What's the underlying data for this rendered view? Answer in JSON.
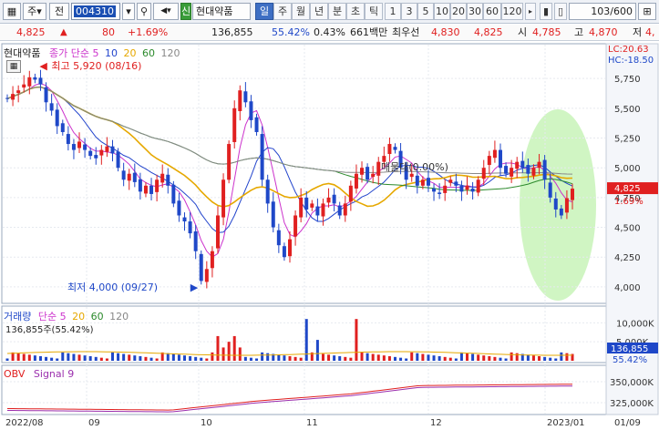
{
  "toolbar": {
    "market_type": "주",
    "prev_label": "전",
    "stock_code": "004310",
    "credit_badge": "신",
    "stock_name": "현대약품",
    "periods": [
      "일",
      "주",
      "월",
      "년",
      "분",
      "초",
      "틱"
    ],
    "active_period": "일",
    "numbers": [
      "1",
      "3",
      "5",
      "10",
      "20",
      "30",
      "60",
      "120"
    ],
    "count_display": "103/600"
  },
  "info": {
    "price": "4,825",
    "change_arrow": "▲",
    "change": "80",
    "change_pct": "+1.69%",
    "volume": "136,855",
    "vol_ratio": "55.42%",
    "turnover_pct": "0.43%",
    "amount": "661백만",
    "best_ask_label": "최우선",
    "best_ask": "4,830",
    "best_bid": "4,825",
    "open_label": "시",
    "open": "4,785",
    "high_label": "고",
    "high": "4,870",
    "low_label": "저",
    "low": "4,"
  },
  "price_pane": {
    "legend_name": "현대약품",
    "legend_ma_label": "종가 단순",
    "ma_periods": [
      "5",
      "10",
      "20",
      "60",
      "120"
    ],
    "ma_colors": [
      "#cc33cc",
      "#2244cc",
      "#e6a800",
      "#2c8a2c",
      "#888888"
    ],
    "lc_label": "LC:20.63",
    "hc_label": "HC:-18.50",
    "high_note": "최고 5,920 (08/16)",
    "low_note": "최저 4,000 (09/27)",
    "trend_note": "매물대(0.00%)",
    "price_ticks": [
      "5,750",
      "5,500",
      "5,250",
      "5,000",
      "4,750",
      "4,500",
      "4,250",
      "4,000"
    ],
    "current_price_tag": "4,825",
    "current_pct_tag": "1.69%"
  },
  "volume_pane": {
    "legend_label": "거래량",
    "legend_ma": "단순",
    "ma_periods": [
      "5",
      "20",
      "60",
      "120"
    ],
    "current_value": "136,855주(55.42%)",
    "ticks": [
      "10,000K",
      "5,000K"
    ],
    "current_tag": "136,855",
    "pct_tag": "55.42%"
  },
  "obv_pane": {
    "legend_obv": "OBV",
    "legend_signal": "Signal 9",
    "ticks": [
      "350,000K",
      "325,000K"
    ]
  },
  "x_axis": [
    "2022/08",
    "09",
    "10",
    "11",
    "12",
    "2023/01",
    "01/09"
  ],
  "colors": {
    "up": "#e02020",
    "down": "#1f48c8",
    "highlight": "#c8f3b8",
    "ma5": "#cc33cc",
    "ma10": "#2244cc",
    "ma20": "#e6a800",
    "ma60": "#2c8a2c",
    "ma120": "#888888"
  },
  "chart_data": {
    "type": "candlestick",
    "y_range": [
      3900,
      5950
    ],
    "x_date_labels": [
      "2022/08",
      "09",
      "10",
      "11",
      "12",
      "2023/01"
    ],
    "ohlc_closes_approx": [
      5580,
      5620,
      5650,
      5700,
      5760,
      5740,
      5700,
      5550,
      5480,
      5350,
      5300,
      5200,
      5150,
      5220,
      5150,
      5100,
      5080,
      5150,
      5180,
      5120,
      5000,
      4900,
      4950,
      4880,
      4800,
      4850,
      4780,
      4900,
      4950,
      4850,
      4700,
      4600,
      4550,
      4450,
      4300,
      4050,
      4150,
      4300,
      4600,
      4900,
      5200,
      5500,
      5650,
      5550,
      5400,
      5300,
      4900,
      4700,
      4500,
      4350,
      4250,
      4400,
      4600,
      4750,
      4650,
      4700,
      4600,
      4700,
      4750,
      4700,
      4600,
      4700,
      4850,
      4950,
      5000,
      4900,
      4950,
      5050,
      5100,
      5200,
      5150,
      5000,
      4900,
      4950,
      4850,
      4900,
      4850,
      4800,
      4780,
      4850,
      4900,
      4850,
      4800,
      4850,
      4800,
      4900,
      5000,
      5100,
      5150,
      5000,
      4950,
      5000,
      5050,
      5000,
      4950,
      5000,
      5050,
      4900,
      4750,
      4650,
      4600,
      4745,
      4825
    ],
    "high": 5920,
    "high_date": "08/16",
    "low": 4000,
    "low_date": "09/27",
    "last_close": 4825,
    "volume_unit": "K",
    "volume_ticks": [
      5000,
      10000
    ],
    "obv_ticks": [
      325000,
      350000
    ]
  }
}
